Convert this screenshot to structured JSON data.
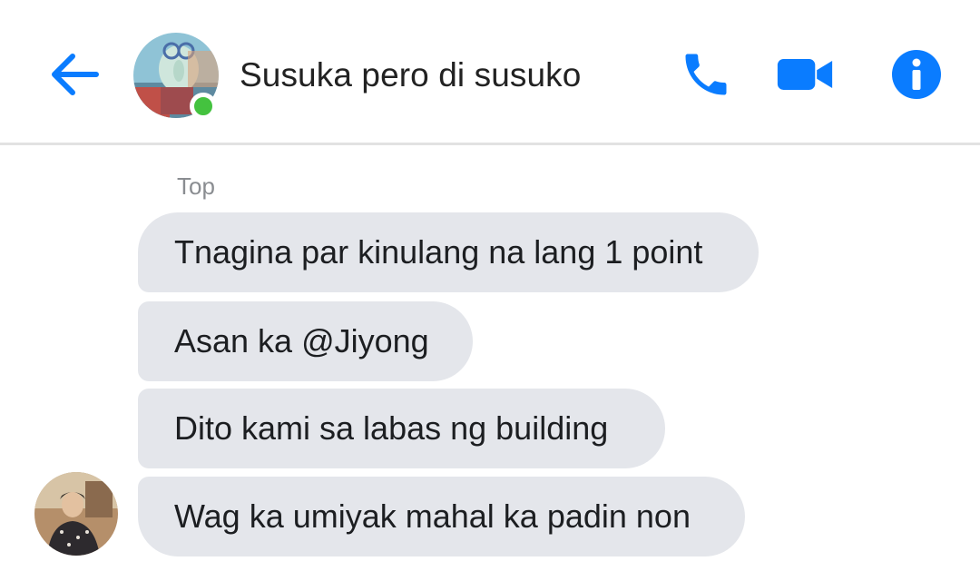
{
  "header": {
    "back_icon": "back-arrow-icon",
    "title": "Susuka pero di susuko",
    "status": "online",
    "call_icon": "phone-icon",
    "video_icon": "video-camera-icon",
    "info_icon": "info-icon",
    "accent_color": "#0a7cff",
    "online_color": "#44c23f"
  },
  "conversation": {
    "divider_label": "Top",
    "messages": [
      {
        "text": "Tnagina par kinulang na lang 1 point"
      },
      {
        "text": "Asan ka @Jiyong"
      },
      {
        "text": "Dito kami sa labas ng building"
      },
      {
        "text": "Wag ka umiyak mahal ka padin non"
      }
    ],
    "bubble_color": "#e4e6eb"
  }
}
